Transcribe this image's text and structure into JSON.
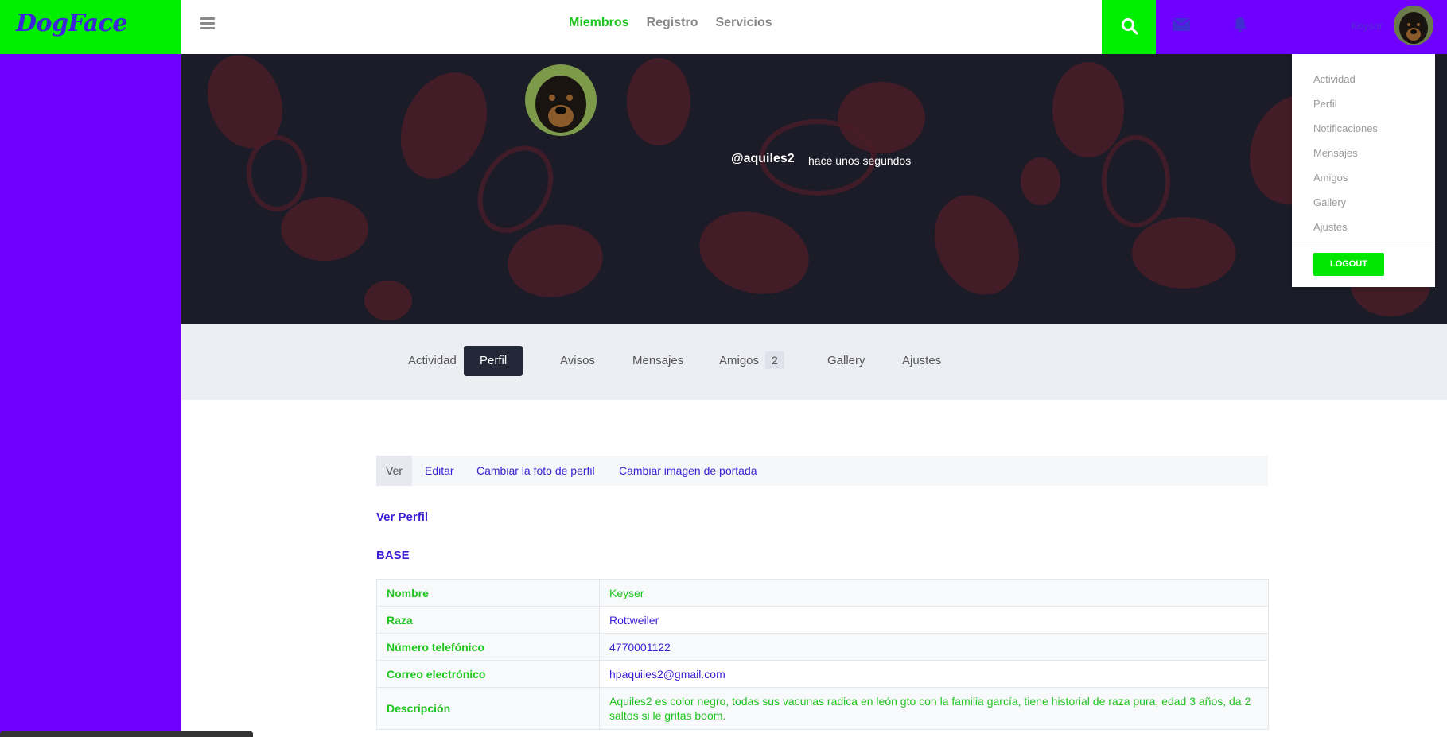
{
  "brand": {
    "name": "DogFace"
  },
  "topnav": {
    "items": [
      "Miembros",
      "Registro",
      "Servicios"
    ]
  },
  "user": {
    "name": "Keyser"
  },
  "dropdown": {
    "items": [
      "Actividad",
      "Perfil",
      "Notificaciones",
      "Mensajes",
      "Amigos",
      "Gallery",
      "Ajustes"
    ],
    "logout": "LOGOUT"
  },
  "profile": {
    "handle": "@aquiles2",
    "time_ago": "hace unos segundos"
  },
  "tabs": {
    "items": [
      "Actividad",
      "Perfil",
      "Avisos",
      "Mensajes",
      "Amigos",
      "Gallery",
      "Ajustes"
    ],
    "active": "Perfil",
    "friends_count": "2"
  },
  "subnav": {
    "items": [
      "Ver",
      "Editar",
      "Cambiar la foto de perfil",
      "Cambiar imagen de portada"
    ],
    "active": "Ver"
  },
  "content": {
    "heading": "Ver Perfil",
    "group": "BASE",
    "fields": [
      {
        "label": "Nombre",
        "value": "Keyser"
      },
      {
        "label": "Raza",
        "value": "Rottweiler"
      },
      {
        "label": "Número telefónico",
        "value": "4770001122"
      },
      {
        "label": "Correo electrónico",
        "value": "hpaquiles2@gmail.com"
      },
      {
        "label": "Descripción",
        "value": "Aquiles2 es color negro, todas sus vacunas radica en león gto con la familia garcía, tiene historial de raza pura, edad 3 años, da 2 saltos si le gritas boom."
      }
    ]
  },
  "colors": {
    "accent_green": "#00ee00",
    "purple": "#6f00ff",
    "link_blue": "#3b1fd6",
    "dark": "#1c1c28"
  }
}
